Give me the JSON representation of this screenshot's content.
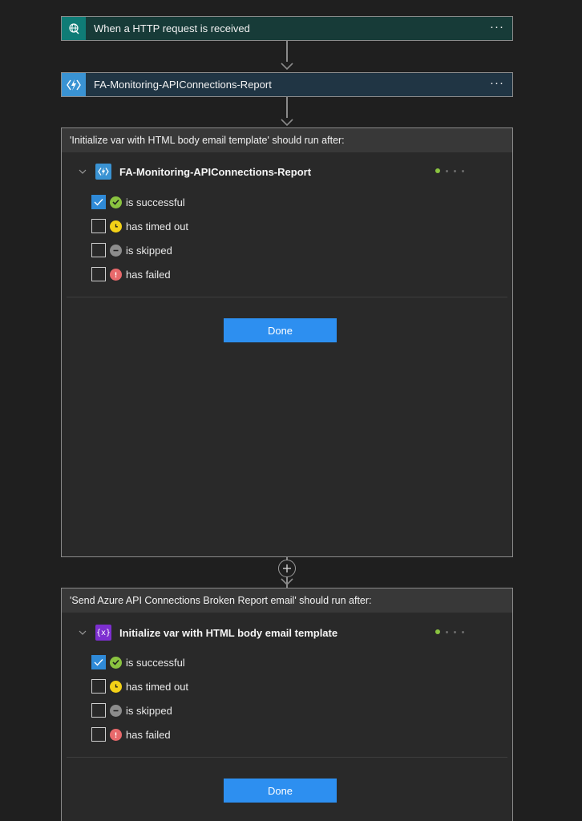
{
  "steps": [
    {
      "title": "When a HTTP request is received",
      "icon": "globe-icon",
      "more": "···"
    },
    {
      "title": "FA-Monitoring-APIConnections-Report",
      "icon": "function-icon",
      "more": "···"
    }
  ],
  "panels": [
    {
      "header": "'Initialize var with HTML body email template' should run after:",
      "action": {
        "name": "FA-Monitoring-APIConnections-Report",
        "icon": "function-icon"
      },
      "options": [
        {
          "label": "is successful",
          "checked": true,
          "status": "success"
        },
        {
          "label": "has timed out",
          "checked": false,
          "status": "timeout"
        },
        {
          "label": "is skipped",
          "checked": false,
          "status": "skipped"
        },
        {
          "label": "has failed",
          "checked": false,
          "status": "failed"
        }
      ],
      "done_label": "Done"
    },
    {
      "header": "'Send Azure API Connections Broken Report email' should run after:",
      "action": {
        "name": "Initialize var with HTML body email template",
        "icon": "variable-icon",
        "icon_text": "{x}"
      },
      "options": [
        {
          "label": "is successful",
          "checked": true,
          "status": "success"
        },
        {
          "label": "has timed out",
          "checked": false,
          "status": "timeout"
        },
        {
          "label": "is skipped",
          "checked": false,
          "status": "skipped"
        },
        {
          "label": "has failed",
          "checked": false,
          "status": "failed"
        }
      ],
      "done_label": "Done"
    }
  ],
  "colors": {
    "accent": "#2d8ff0",
    "success": "#8ac340",
    "timeout": "#f3d117",
    "skipped": "#8c8c8c",
    "failed": "#e8696b",
    "teal": "#0f7c76",
    "azure": "#3a93d3",
    "purple": "#7d2fd0"
  }
}
